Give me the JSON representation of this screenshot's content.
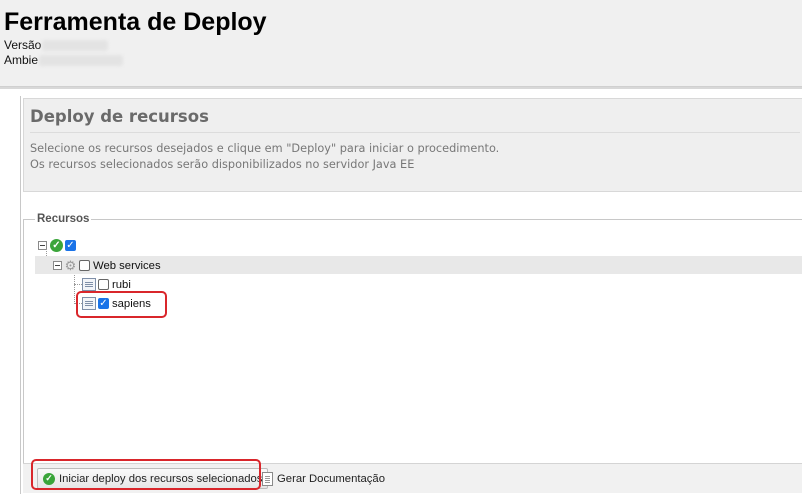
{
  "header": {
    "title": "Ferramenta de Deploy",
    "version_label": "Versão",
    "environment_label": "Ambie"
  },
  "panel": {
    "title": "Deploy de recursos",
    "line1": "Selecione os recursos desejados e clique em \"Deploy\" para iniciar o procedimento.",
    "line2": "Os recursos selecionados serão disponibilizados no servidor Java EE"
  },
  "resources": {
    "legend": "Recursos",
    "root": {
      "checked": true,
      "status_icon": "check-circle-icon"
    },
    "group": {
      "label": "Web services",
      "checked": false,
      "icon": "gear-icon"
    },
    "items": [
      {
        "label": "rubi",
        "checked": false,
        "icon": "service-doc-icon"
      },
      {
        "label": "sapiens",
        "checked": true,
        "icon": "service-doc-icon",
        "highlighted": true
      }
    ]
  },
  "toolbar": {
    "deploy_label": "Iniciar deploy dos recursos selecionados",
    "docs_label": "Gerar Documentação"
  },
  "colors": {
    "highlight": "#d9262b",
    "checkbox_checked": "#1a73e8",
    "ok_green": "#3aa53a"
  }
}
